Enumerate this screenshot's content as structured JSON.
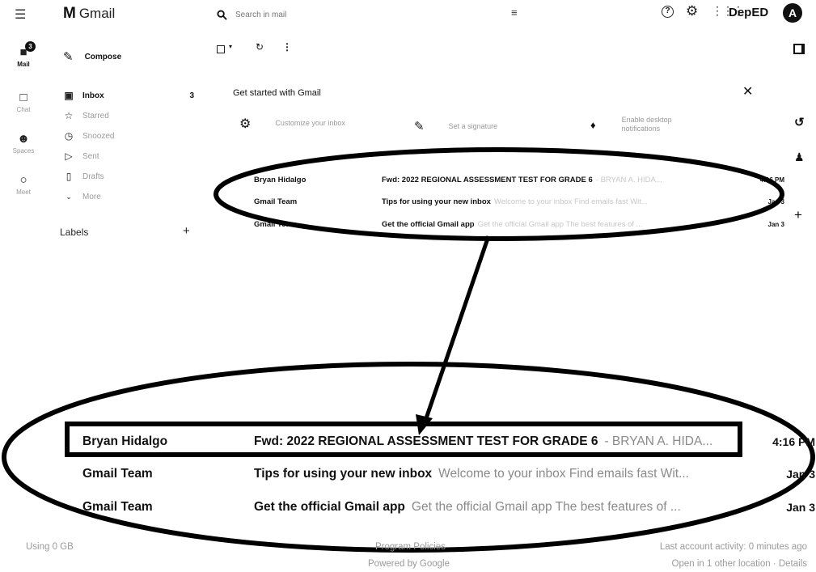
{
  "topbar": {
    "app_name": "Gmail",
    "search_placeholder": "Search in mail",
    "org_logo": "DepED",
    "avatar_letter": "A"
  },
  "rail": {
    "mail_label": "Mail",
    "mail_badge": "3",
    "chat_label": "Chat",
    "spaces_label": "Spaces",
    "meet_label": "Meet"
  },
  "sidebar": {
    "compose_label": "Compose",
    "items": [
      {
        "label": "Inbox",
        "count": "3",
        "icon": "inbox-icon"
      },
      {
        "label": "Starred",
        "count": "",
        "icon": "star-icon"
      },
      {
        "label": "Snoozed",
        "count": "",
        "icon": "clock-icon"
      },
      {
        "label": "Sent",
        "count": "",
        "icon": "send-icon"
      },
      {
        "label": "Drafts",
        "count": "",
        "icon": "draft-icon"
      },
      {
        "label": "More",
        "count": "",
        "icon": "chevron-down-icon"
      }
    ],
    "labels_heading": "Labels"
  },
  "get_started": {
    "title": "Get started with Gmail",
    "items": [
      {
        "label": "Customize your inbox",
        "icon": "gear-icon"
      },
      {
        "label": "Set a signature",
        "icon": "pen-icon"
      },
      {
        "label": "Enable desktop notifications",
        "icon": "bell-icon"
      }
    ]
  },
  "emails": [
    {
      "from": "Bryan Hidalgo",
      "subject": "Fwd: 2022 REGIONAL ASSESSMENT TEST FOR GRADE 6",
      "snippet": "- BRYAN A. HIDA...",
      "date": "4:16 PM"
    },
    {
      "from": "Gmail Team",
      "subject": "Tips for using your new inbox",
      "snippet": "Welcome to your inbox Find emails fast Wit...",
      "date": "Jan 3"
    },
    {
      "from": "Gmail Team",
      "subject": "Get the official Gmail app",
      "snippet": "Get the official Gmail app The best features of ...",
      "date": "Jan 3"
    }
  ],
  "footer": {
    "storage": "Using 0 GB",
    "policies": "Program Policies",
    "powered": "Powered by Google",
    "activity": "Last account activity: 0 minutes ago",
    "location": "Open in 1 other location · Details"
  }
}
